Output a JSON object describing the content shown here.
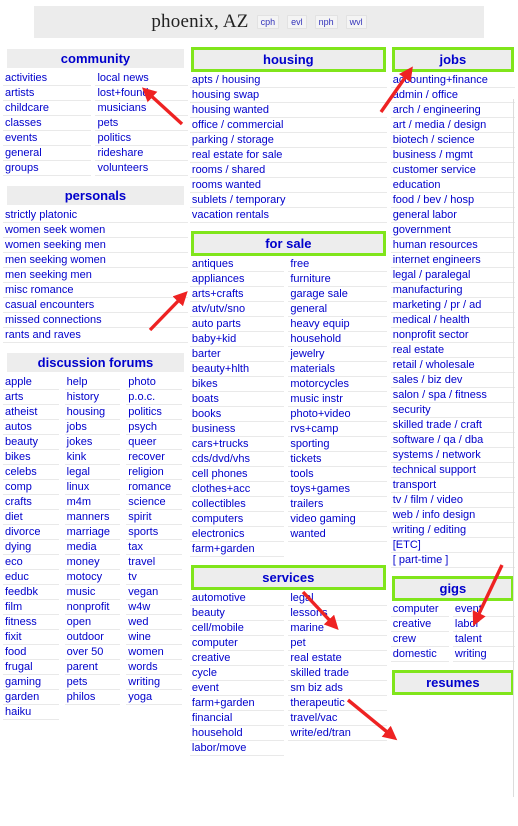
{
  "header": {
    "city": "phoenix, AZ",
    "nearby": [
      "cph",
      "evl",
      "nph",
      "wvl"
    ]
  },
  "colors": {
    "link": "#0000cc",
    "highlight_green": "#80e51b",
    "arrow_red": "#ee2222",
    "header_bg": "#ededed"
  },
  "sections": {
    "community": {
      "title": "community",
      "highlighted": false,
      "columns": [
        [
          "activities",
          "artists",
          "childcare",
          "classes",
          "events",
          "general",
          "groups"
        ],
        [
          "local news",
          "lost+found",
          "musicians",
          "pets",
          "politics",
          "rideshare",
          "volunteers"
        ]
      ]
    },
    "personals": {
      "title": "personals",
      "highlighted": false,
      "columns": [
        [
          "strictly platonic",
          "women seek women",
          "women seeking men",
          "men seeking women",
          "men seeking men",
          "misc romance",
          "casual encounters",
          "missed connections",
          "rants and raves"
        ]
      ]
    },
    "discussion_forums": {
      "title": "discussion forums",
      "highlighted": false,
      "columns": [
        [
          "apple",
          "arts",
          "atheist",
          "autos",
          "beauty",
          "bikes",
          "celebs",
          "comp",
          "crafts",
          "diet",
          "divorce",
          "dying",
          "eco",
          "educ",
          "feedbk",
          "film",
          "fitness",
          "fixit",
          "food",
          "frugal",
          "gaming",
          "garden",
          "haiku"
        ],
        [
          "help",
          "history",
          "housing",
          "jobs",
          "jokes",
          "kink",
          "legal",
          "linux",
          "m4m",
          "manners",
          "marriage",
          "media",
          "money",
          "motocy",
          "music",
          "nonprofit",
          "open",
          "outdoor",
          "over 50",
          "parent",
          "pets",
          "philos"
        ],
        [
          "photo",
          "p.o.c.",
          "politics",
          "psych",
          "queer",
          "recover",
          "religion",
          "romance",
          "science",
          "spirit",
          "sports",
          "tax",
          "travel",
          "tv",
          "vegan",
          "w4w",
          "wed",
          "wine",
          "women",
          "words",
          "writing",
          "yoga"
        ]
      ]
    },
    "housing": {
      "title": "housing",
      "highlighted": true,
      "columns": [
        [
          "apts / housing",
          "housing swap",
          "housing wanted",
          "office / commercial",
          "parking / storage",
          "real estate for sale",
          "rooms / shared",
          "rooms wanted",
          "sublets / temporary",
          "vacation rentals"
        ]
      ]
    },
    "for_sale": {
      "title": "for sale",
      "highlighted": true,
      "columns": [
        [
          "antiques",
          "appliances",
          "arts+crafts",
          "atv/utv/sno",
          "auto parts",
          "baby+kid",
          "barter",
          "beauty+hlth",
          "bikes",
          "boats",
          "books",
          "business",
          "cars+trucks",
          "cds/dvd/vhs",
          "cell phones",
          "clothes+acc",
          "collectibles",
          "computers",
          "electronics",
          "farm+garden"
        ],
        [
          "free",
          "furniture",
          "garage sale",
          "general",
          "heavy equip",
          "household",
          "jewelry",
          "materials",
          "motorcycles",
          "music instr",
          "photo+video",
          "rvs+camp",
          "sporting",
          "tickets",
          "tools",
          "toys+games",
          "trailers",
          "video gaming",
          "wanted"
        ]
      ]
    },
    "services": {
      "title": "services",
      "highlighted": true,
      "columns": [
        [
          "automotive",
          "beauty",
          "cell/mobile",
          "computer",
          "creative",
          "cycle",
          "event",
          "farm+garden",
          "financial",
          "household",
          "labor/move"
        ],
        [
          "legal",
          "lessons",
          "marine",
          "pet",
          "real estate",
          "skilled trade",
          "sm biz ads",
          "therapeutic",
          "travel/vac",
          "write/ed/tran"
        ]
      ]
    },
    "jobs": {
      "title": "jobs",
      "highlighted": true,
      "columns": [
        [
          "accounting+finance",
          "admin / office",
          "arch / engineering",
          "art / media / design",
          "biotech / science",
          "business / mgmt",
          "customer service",
          "education",
          "food / bev / hosp",
          "general labor",
          "government",
          "human resources",
          "internet engineers",
          "legal / paralegal",
          "manufacturing",
          "marketing / pr / ad",
          "medical / health",
          "nonprofit sector",
          "real estate",
          "retail / wholesale",
          "sales / biz dev",
          "salon / spa / fitness",
          "security",
          "skilled trade / craft",
          "software / qa / dba",
          "systems / network",
          "technical support",
          "transport",
          "tv / film / video",
          "web / info design",
          "writing / editing",
          "[ETC]",
          "[ part-time ]"
        ]
      ]
    },
    "gigs": {
      "title": "gigs",
      "highlighted": true,
      "columns": [
        [
          "computer",
          "creative",
          "crew",
          "domestic"
        ],
        [
          "event",
          "labor",
          "talent",
          "writing"
        ]
      ]
    },
    "resumes": {
      "title": "resumes",
      "highlighted": true,
      "columns": []
    }
  }
}
